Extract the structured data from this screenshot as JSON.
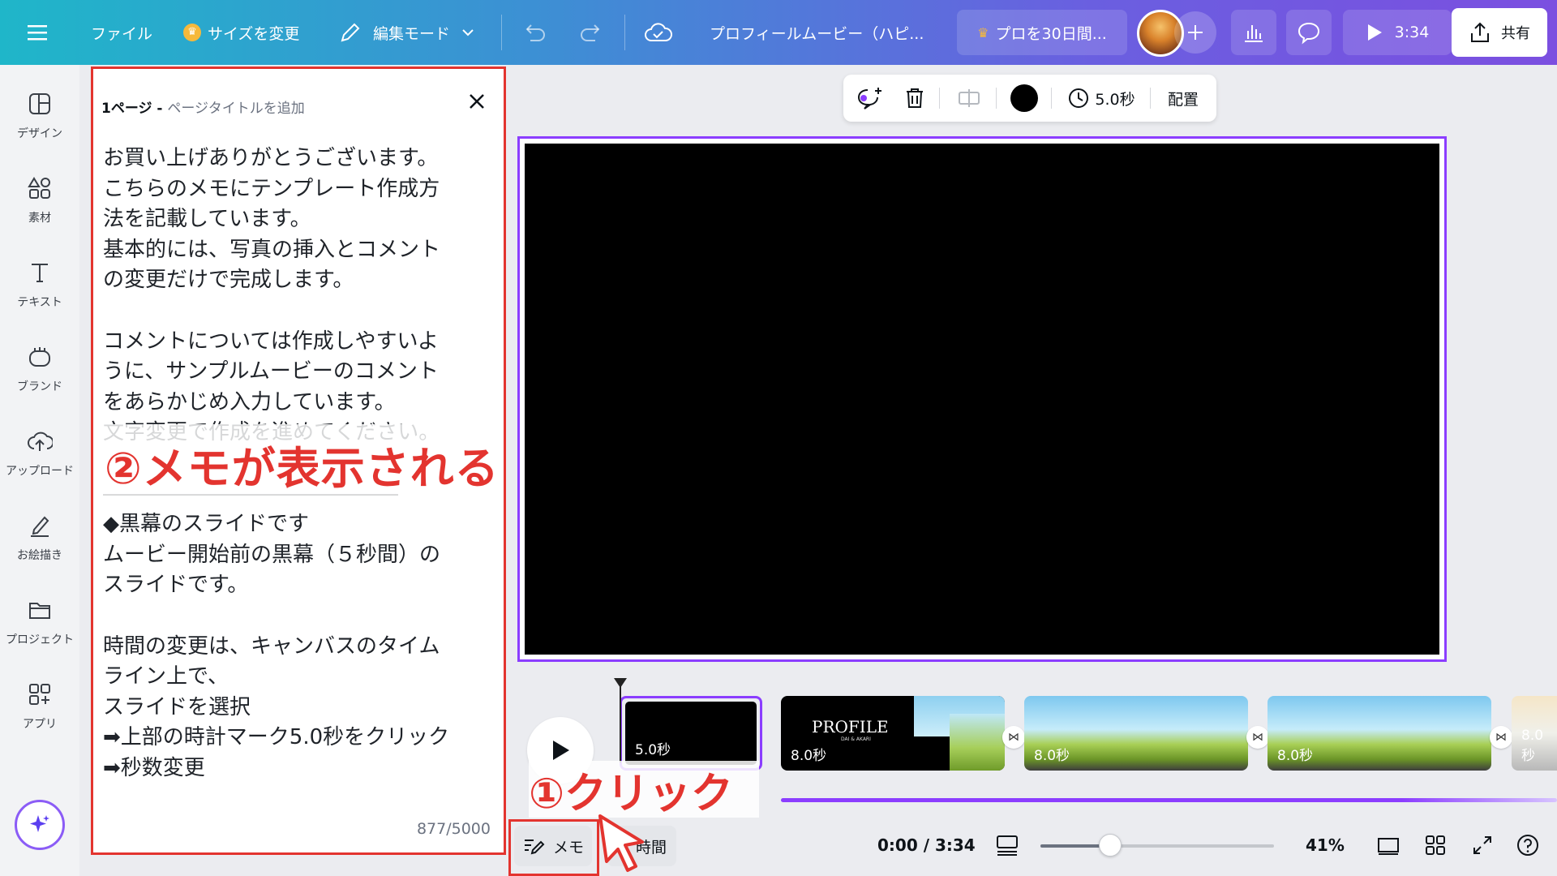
{
  "topbar": {
    "file_label": "ファイル",
    "resize_label": "サイズを変更",
    "edit_mode_label": "編集モード",
    "doc_title": "プロフィールムービー（ハピ...",
    "pro_trial_label": "プロを30日間...",
    "play_time": "3:34",
    "share_label": "共有"
  },
  "sidebar": {
    "items": [
      {
        "label": "デザイン"
      },
      {
        "label": "素材"
      },
      {
        "label": "テキスト"
      },
      {
        "label": "ブランド"
      },
      {
        "label": "アップロード"
      },
      {
        "label": "お絵描き"
      },
      {
        "label": "プロジェクト"
      },
      {
        "label": "アプリ"
      }
    ]
  },
  "notes": {
    "page_label": "1ページ - ",
    "page_title_placeholder": "ページタイトルを追加",
    "body": "お買い上げありがとうございます。\nこちらのメモにテンプレート作成方\n法を記載しています。\n基本的には、写真の挿入とコメント\nの変更だけで完成します。\n\nコメントについては作成しやすいよ\nうに、サンプルムービーのコメント\nをあらかじめ入力しています。\n文字変更で作成を進めてください。\n\n――――――――――――――\n◆黒幕のスライドです\nムービー開始前の黒幕（５秒間）の\nスライドです。\n\n時間の変更は、キャンバスのタイム\nライン上で、\nスライドを選択\n➡上部の時計マーク5.0秒をクリック\n➡秒数変更",
    "char_count": "877/5000"
  },
  "annotations": {
    "callout_1": "①クリック",
    "callout_2": "②メモが表示される",
    "highlight_color": "#e3342f"
  },
  "float_toolbar": {
    "duration": "5.0秒",
    "position_label": "配置"
  },
  "timeline": {
    "clips": [
      {
        "duration": "5.0秒"
      },
      {
        "duration": "8.0秒",
        "title": "PROFILE",
        "subtitle": "DAI & AKARI"
      },
      {
        "duration": "8.0秒"
      },
      {
        "duration": "8.0秒"
      },
      {
        "duration": "8.0秒"
      }
    ]
  },
  "bottombar": {
    "memo_label": "メモ",
    "time_label": "時間",
    "timecode": "0:00 / 3:34",
    "zoom": "41%",
    "zoom_slider_fraction": 0.3
  },
  "colors": {
    "accent": "#8b3dff",
    "annotation_red": "#e3342f"
  }
}
